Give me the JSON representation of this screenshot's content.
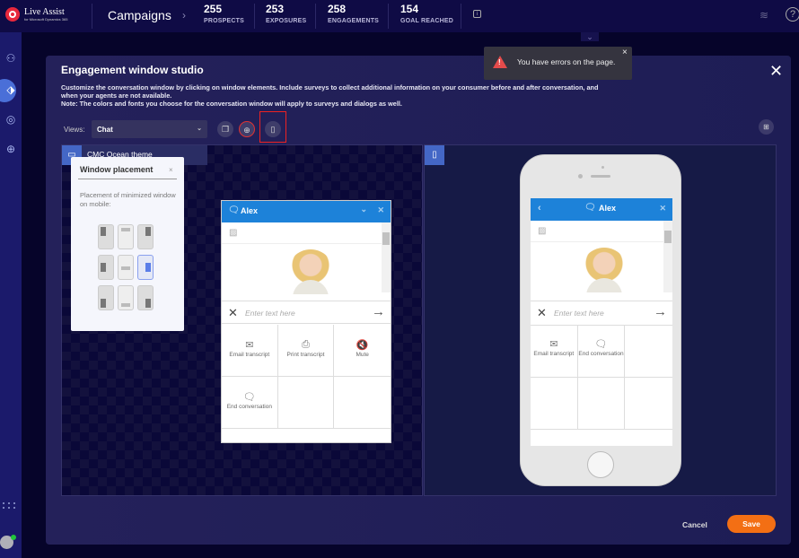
{
  "topbar": {
    "logo_text": "Live Assist",
    "logo_subtext": "for Microsoft Dynamics 365",
    "title": "Campaigns",
    "stats": [
      {
        "value": "255",
        "label": "PROSPECTS"
      },
      {
        "value": "253",
        "label": "EXPOSURES"
      },
      {
        "value": "258",
        "label": "ENGAGEMENTS"
      },
      {
        "value": "154",
        "label": "GOAL REACHED"
      }
    ],
    "help_glyph": "?"
  },
  "toast": {
    "message": "You have errors on the page.",
    "close": "×"
  },
  "modal": {
    "title": "Engagement window studio",
    "description": "Customize the conversation window by clicking on window elements. Include surveys to collect additional information on your consumer before and after conversation, and when your agents are not available.",
    "note": "Note: The colors and fonts you choose for the conversation window will apply to surveys and dialogs as well.",
    "close": "✕",
    "views_label": "Views:",
    "views_value": "Chat",
    "theme_name": "CMC Ocean theme",
    "cancel_label": "Cancel",
    "save_label": "Save"
  },
  "placement": {
    "title": "Window placement",
    "close": "×",
    "description": "Placement of minimized window on mobile:",
    "selected": "middle-right"
  },
  "chat": {
    "agent_name": "Alex",
    "input_placeholder": "Enter text here",
    "desktop_actions": [
      {
        "icon": "✉",
        "label": "Email transcript"
      },
      {
        "icon": "⎙",
        "label": "Print transcript"
      },
      {
        "icon": "🔇",
        "label": "Mute"
      },
      {
        "icon": "🗨",
        "label": "End conversation"
      },
      {
        "icon": "",
        "label": ""
      },
      {
        "icon": "",
        "label": ""
      }
    ],
    "mobile_actions": [
      {
        "icon": "✉",
        "label": "Email transcript"
      },
      {
        "icon": "🗨",
        "label": "End conversation"
      },
      {
        "icon": "",
        "label": ""
      },
      {
        "icon": "",
        "label": ""
      },
      {
        "icon": "",
        "label": ""
      },
      {
        "icon": "",
        "label": ""
      }
    ]
  },
  "colors": {
    "accent": "#1d82d9",
    "save": "#f36f14",
    "error": "#e44b4b",
    "topbar": "#0f0b45"
  }
}
